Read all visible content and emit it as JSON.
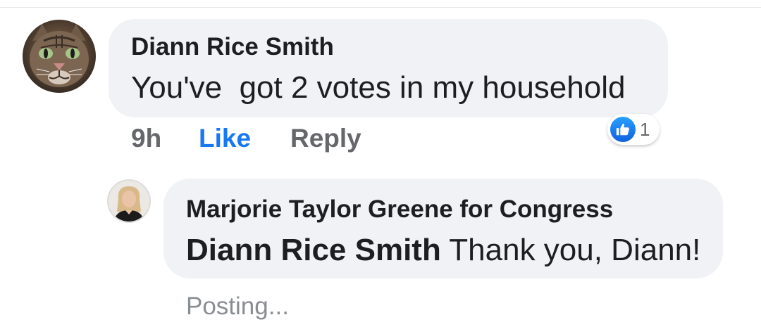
{
  "comments": [
    {
      "author": "Diann Rice Smith",
      "text": "You've  got 2 votes in my household",
      "time": "9h",
      "like_label": "Like",
      "reply_label": "Reply",
      "reaction_count": "1",
      "avatar_icon": "cat-avatar"
    }
  ],
  "reply": {
    "author": "Marjorie Taylor Greene for Congress",
    "mention": "Diann Rice Smith",
    "text": " Thank you, Diann!",
    "avatar_icon": "person-avatar",
    "status": "Posting..."
  },
  "colors": {
    "bubble_bg": "#f0f2f5",
    "like_blue": "#1877f2",
    "meta_gray": "#65676b",
    "posting_gray": "#8a8d91"
  }
}
